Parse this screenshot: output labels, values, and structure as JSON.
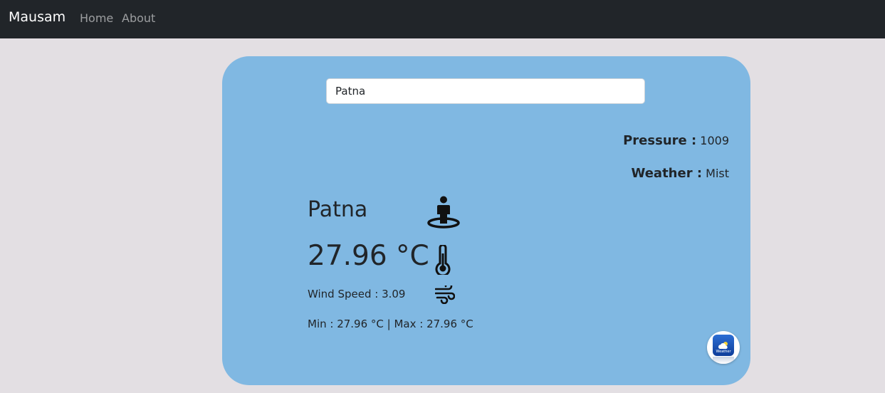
{
  "navbar": {
    "brand": "Mausam",
    "links": [
      "Home",
      "About"
    ]
  },
  "search": {
    "value": "Patna",
    "placeholder": ""
  },
  "info": {
    "pressure_label": "Pressure :",
    "pressure_value": "1009",
    "weather_label": "Weather :",
    "weather_value": "Mist"
  },
  "current": {
    "city": "Patna",
    "temperature": "27.96 °C",
    "wind": "Wind Speed : 3.09",
    "minmax": "Min : 27.96 °C | Max : 27.96 °C"
  },
  "app_badge": {
    "label": "Weather"
  },
  "icons": [
    "person-location-icon",
    "thermometer-icon",
    "wind-icon",
    "weather-app-icon"
  ],
  "colors": {
    "navbar": "#212529",
    "page_background": "#e3dfe3",
    "card_background": "#80b8e2"
  }
}
